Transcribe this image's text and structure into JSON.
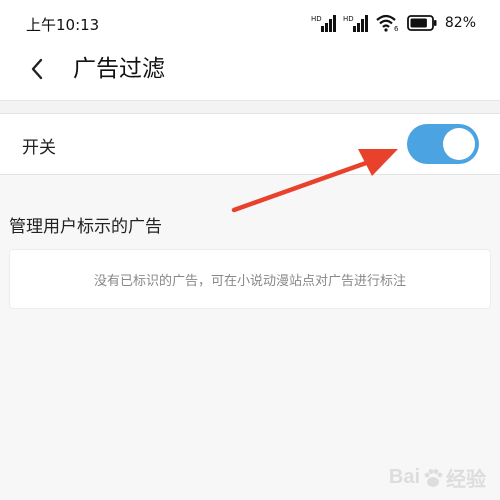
{
  "status_bar": {
    "time": "上午10:13",
    "signal_1_label": "HD",
    "signal_2_label": "HD",
    "wifi_label": "6",
    "battery_percent": "82%",
    "battery_level": 0.82,
    "icons": [
      "signal-icon",
      "signal-icon",
      "wifi-icon",
      "battery-icon"
    ]
  },
  "header": {
    "back_icon": "chevron-left-icon",
    "title": "广告过滤"
  },
  "ad_filter_switch": {
    "label": "开关",
    "state": "on",
    "accent_color": "#4ba3e2"
  },
  "user_marked_ads": {
    "section_title": "管理用户标示的广告",
    "empty_message": "没有已标识的广告，可在小说动漫站点对广告进行标注"
  },
  "annotation": {
    "arrow_color": "#e8412c",
    "points_to": "ad-filter-toggle"
  },
  "watermark": {
    "text_left": "Bai",
    "text_right": "经验",
    "icon": "paw-icon"
  }
}
